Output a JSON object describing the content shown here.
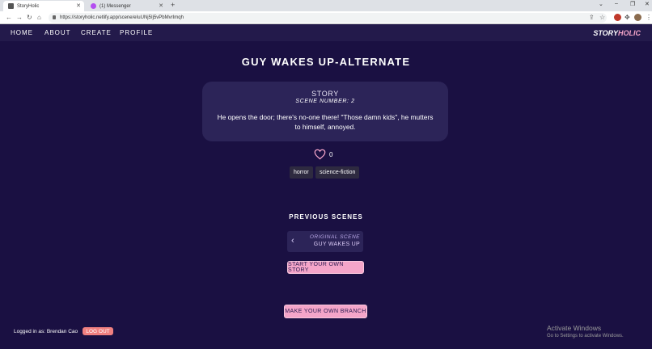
{
  "browser": {
    "tabs": [
      {
        "title": "StoryHolic",
        "active": true
      },
      {
        "title": "(1) Messenger",
        "active": false
      }
    ],
    "url": "https://storyholic.netlify.app/scene/eIuUNj5Ij5vPbMvrImqh",
    "new_tab": "+",
    "window_controls": [
      "⌄",
      "–",
      "❐",
      "✕"
    ]
  },
  "site_nav": {
    "links": [
      "HOME",
      "ABOUT",
      "CREATE",
      "PROFILE"
    ],
    "logo_part1": "STORY",
    "logo_part2": "HOLIC"
  },
  "scene": {
    "title": "GUY WAKES UP-ALTERNATE",
    "card_label": "STORY",
    "scene_number_label": "SCENE NUMBER: 2",
    "text": "He opens the door; there's no-one there! \"Those damn kids\", he mutters to himself, annoyed.",
    "likes": "0",
    "tags": [
      "horror",
      "science-fiction"
    ]
  },
  "previous": {
    "heading": "PREVIOUS SCENES",
    "items": [
      {
        "label": "ORIGINAL SCENE",
        "name": "GUY WAKES UP"
      }
    ]
  },
  "buttons": {
    "start_story": "START YOUR OWN STORY",
    "make_branch": "MAKE YOUR OWN BRANCH",
    "logout": "LOG OUT"
  },
  "footer": {
    "logged_in": "Logged in as: Brendan Cao"
  },
  "watermark": {
    "line1": "Activate Windows",
    "line2": "Go to Settings to activate Windows."
  },
  "colors": {
    "background": "#1a1042",
    "card": "#2c2458",
    "accent_pink": "#f4a5c9",
    "logout": "#f08080"
  }
}
